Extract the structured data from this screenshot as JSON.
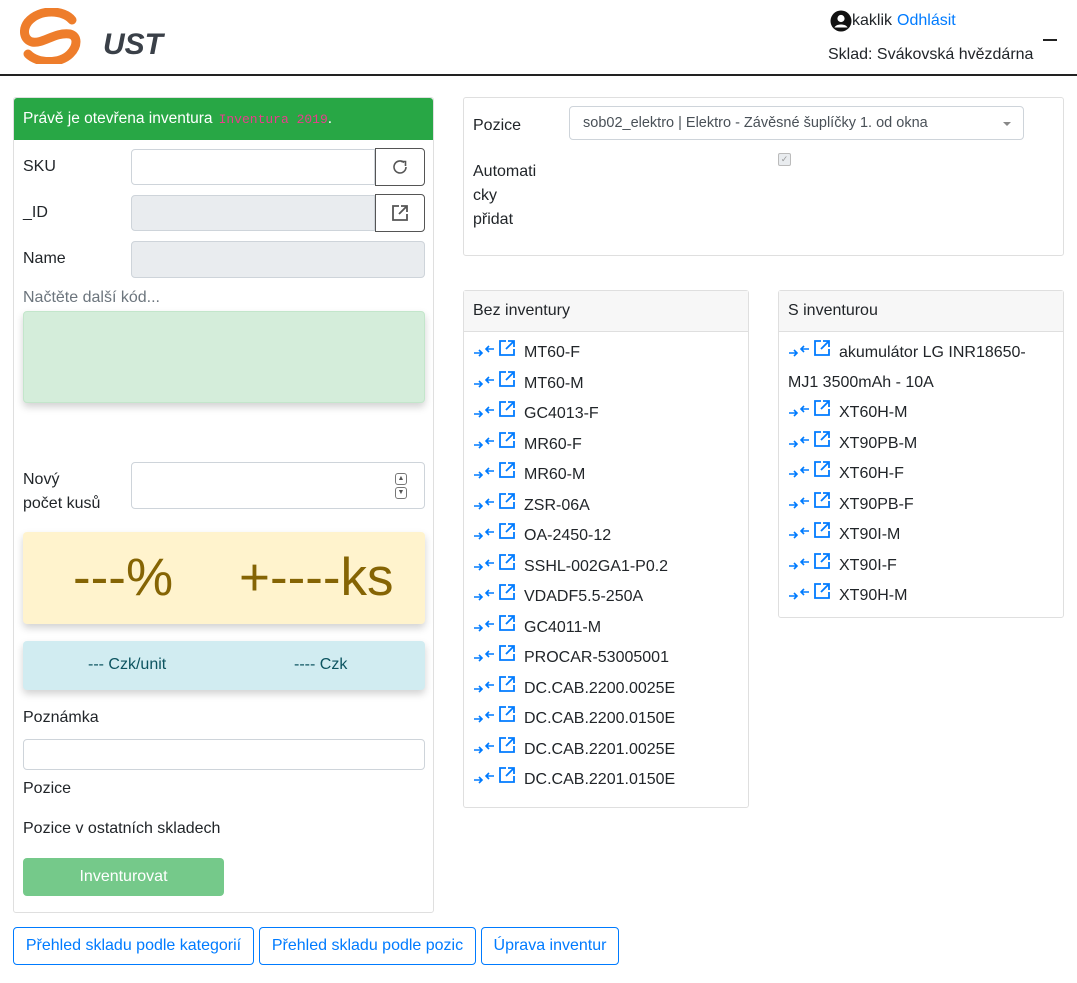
{
  "header": {
    "logo_text": "UST",
    "username": "kaklik",
    "logout": "Odhlásit",
    "sklad": "Sklad: Svákovská hvězdárna"
  },
  "inventory": {
    "banner_text": "Právě je otevřena inventura",
    "banner_code": "Inventura 2019",
    "banner_end": ".",
    "sku_label": "SKU",
    "id_label": "_ID",
    "name_label": "Name",
    "scan_hint": "Načtěte další kód...",
    "count_label_1": "Nový",
    "count_label_2": "počet kusů",
    "pct": "---%",
    "ks": "+----ks",
    "czk_unit": "--- Czk/unit",
    "czk": "---- Czk",
    "note_label": "Poznámka",
    "pozice_label": "Pozice",
    "other_label": "Pozice v ostatních skladech",
    "submit": "Inventurovat"
  },
  "position": {
    "label": "Pozice",
    "selected": "sob02_elektro | Elektro - Závěsné šuplíčky 1. od okna",
    "auto_1": "Automati",
    "auto_2": "cky",
    "auto_3": "přidat"
  },
  "bez": {
    "title": "Bez inventury",
    "items": [
      "MT60-F",
      "MT60-M",
      "GC4013-F",
      "MR60-F",
      "MR60-M",
      "ZSR-06A",
      "OA-2450-12",
      "SSHL-002GA1-P0.2",
      "VDADF5.5-250A",
      "GC4011-M",
      "PROCAR-53005001",
      "DC.CAB.2200.0025E",
      "DC.CAB.2200.0150E",
      "DC.CAB.2201.0025E",
      "DC.CAB.2201.0150E"
    ]
  },
  "sinv": {
    "title": "S inventurou",
    "first_line1": "akumulátor LG INR18650-",
    "first_line2": "MJ1 3500mAh - 10A",
    "items": [
      "XT60H-M",
      "XT90PB-M",
      "XT60H-F",
      "XT90PB-F",
      "XT90I-M",
      "XT90I-F",
      "XT90H-M"
    ]
  },
  "nav": {
    "kategorie": "Přehled skladu podle kategorií",
    "pozice": "Přehled skladu podle pozic",
    "uprava": "Úprava inventur"
  },
  "colors": {
    "success": "#28a745",
    "primary": "#007bff",
    "logo_orange": "#ee7d2b"
  }
}
